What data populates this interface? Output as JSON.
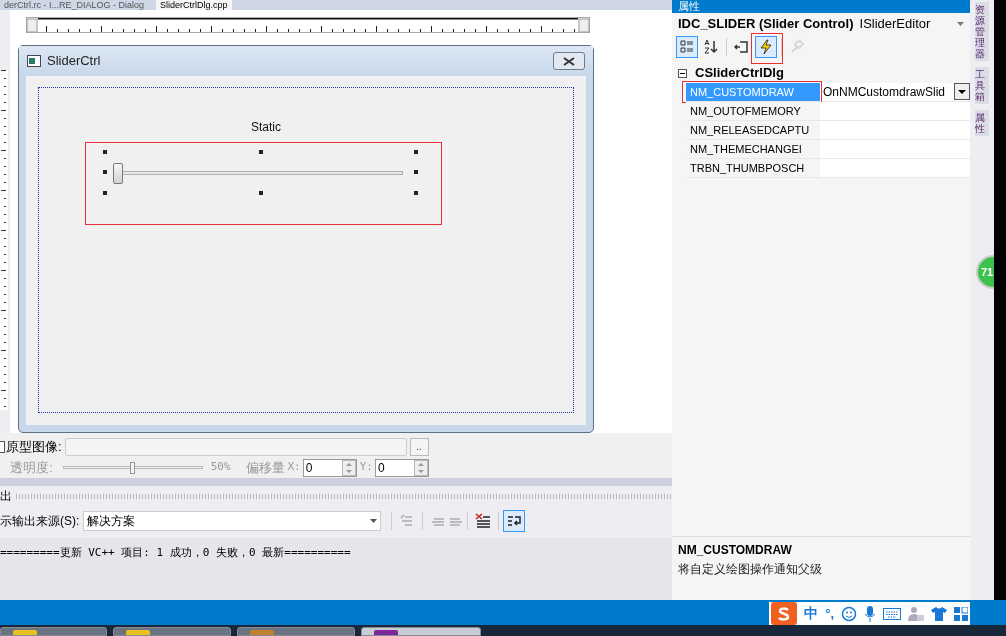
{
  "document_tabs": [
    {
      "label": "derCtrl.rc - I...RE_DIALOG - Dialog",
      "selected": false
    },
    {
      "label": "SliderCtrlDlg.cpp",
      "selected": true
    }
  ],
  "dialog": {
    "title": "SliderCtrl",
    "static_label": "Static",
    "slider": {
      "level": 0
    }
  },
  "image_bar": {
    "checked": false,
    "label": "原型图像:",
    "browse_button": "..",
    "opacity_label": "透明度:",
    "opacity": {
      "level": 0.5
    },
    "opacity_reading": "50%",
    "offset_label": "偏移量",
    "x_label": "X:",
    "x_value": "0",
    "y_label": "Y:",
    "y_value": "0"
  },
  "output": {
    "title": "出",
    "source_label": "示输出来源(S):",
    "source_value": "解决方案",
    "lines": [
      "=========更新 VC++ 项目: 1 成功，0 失败，0 最新=========="
    ]
  },
  "properties": {
    "title": "属性",
    "object": "IDC_SLIDER (Slider Control)",
    "editor": "ISliderEditor",
    "toolbar": [
      {
        "kind": "categorized",
        "selected": true,
        "disabled": false
      },
      {
        "kind": "alphabetical",
        "selected": false,
        "disabled": false
      },
      {
        "kind": "properties",
        "selected": false,
        "disabled": false
      },
      {
        "kind": "events",
        "selected": true,
        "disabled": false
      },
      {
        "kind": "pages",
        "selected": false,
        "disabled": true
      }
    ],
    "class_name": "CSliderCtrlDlg",
    "expanded": true,
    "events": [
      {
        "name": "NM_CUSTOMDRAW",
        "handler": "OnNMCustomdrawSlid",
        "selected": true
      },
      {
        "name": "NM_OUTOFMEMORY",
        "selected": false
      },
      {
        "name": "NM_RELEASEDCAPTU",
        "selected": false
      },
      {
        "name": "NM_THEMECHANGEI",
        "selected": false
      },
      {
        "name": "TRBN_THUMBPOSCH",
        "selected": false
      }
    ],
    "description": {
      "title": "NM_CUSTOMDRAW",
      "text": "将自定义绘图操作通知父级"
    }
  },
  "side_tabs": [
    "资源管理器",
    "工具箱",
    "属性"
  ],
  "badge": "71",
  "ime_toolbar": {
    "mode": "中",
    "punctuation": "°,"
  },
  "taskbar": [
    {
      "selected": false
    },
    {
      "selected": false
    },
    {
      "selected": false
    },
    {
      "selected": true
    }
  ]
}
